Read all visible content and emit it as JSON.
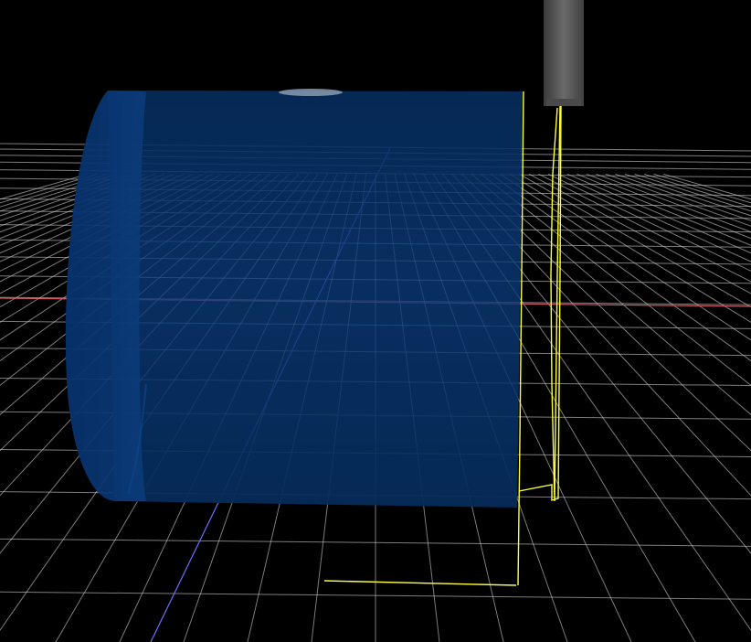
{
  "app": {
    "title": ""
  },
  "colors": {
    "background": "#000000",
    "grid": "#c8c8c8",
    "x_axis": "#d05a63",
    "y_axis": "#6e6eff",
    "stock": "#0a3a7a",
    "toolpath": "#ffff40",
    "tool": "#555555"
  },
  "scene": {
    "view": "3d-perspective",
    "objects": [
      {
        "name": "cylindrical-stock",
        "shape": "cylinder"
      },
      {
        "name": "cutting-tool",
        "shape": "end-mill"
      },
      {
        "name": "toolpath",
        "shape": "polyline"
      }
    ],
    "grid_visible": true,
    "axes_visible": true
  }
}
